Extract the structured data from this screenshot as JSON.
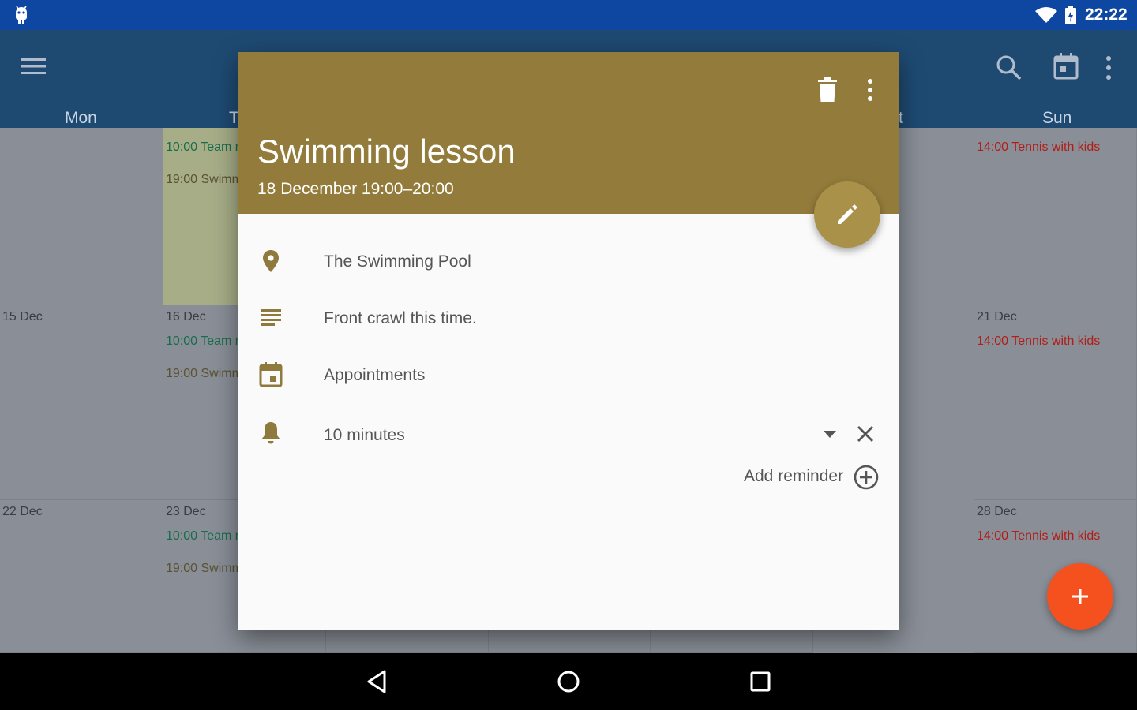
{
  "status_bar": {
    "time": "22:22",
    "icons": [
      "android-icon",
      "wifi-icon",
      "battery-icon"
    ]
  },
  "app_bar": {
    "icons": [
      "menu-icon",
      "search-icon",
      "calendar-icon",
      "more-vert-icon"
    ]
  },
  "calendar": {
    "day_headers": [
      "Mon",
      "T",
      "t",
      "Sun"
    ],
    "row1": {
      "tue_events": [
        "10:00 Team m",
        "19:00 Swimm"
      ],
      "sun_events": [
        "14:00 Tennis with kids"
      ]
    },
    "row2": {
      "mon_date": "15 Dec",
      "tue_date": "16 Dec",
      "tue_events": [
        "10:00 Team m",
        "19:00 Swimm"
      ],
      "sun_date": "21 Dec",
      "sun_events": [
        "14:00 Tennis with kids"
      ]
    },
    "row3": {
      "mon_date": "22 Dec",
      "tue_date": "23 Dec",
      "tue_events": [
        "10:00 Team m",
        "19:00 Swimm"
      ],
      "sun_date": "28 Dec",
      "sun_events": [
        "14:00 Tennis with kids"
      ]
    }
  },
  "event_dialog": {
    "title": "Swimming lesson",
    "subtitle": "18 December 19:00–20:00",
    "location": "The Swimming Pool",
    "description": "Front crawl this time.",
    "calendar_name": "Appointments",
    "reminder": "10 minutes",
    "add_reminder": "Add reminder",
    "header_color": "#937b3b",
    "accent_color": "#aa9149",
    "icons": [
      "delete-icon",
      "more-vert-icon",
      "edit-icon",
      "location-icon",
      "notes-icon",
      "event-icon",
      "bell-icon",
      "dropdown-arrow-icon",
      "close-icon",
      "add-circle-icon"
    ]
  },
  "fab": {
    "icon": "plus-icon",
    "color": "#f4511e"
  },
  "nav_bar": {
    "icons": [
      "back-icon",
      "home-icon",
      "recents-icon"
    ]
  }
}
